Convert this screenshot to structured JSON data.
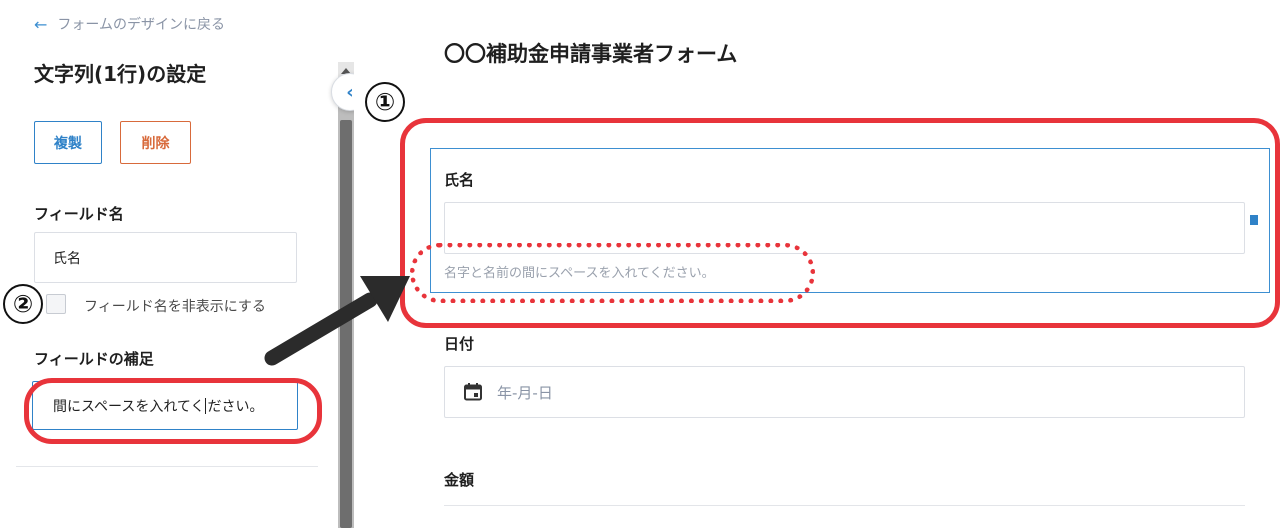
{
  "sidebar": {
    "back_label": "フォームのデザインに戻る",
    "title": "文字列(1行)の設定",
    "duplicate_label": "複製",
    "delete_label": "削除",
    "field_name_heading": "フィールド名",
    "field_name_value": "氏名",
    "hide_field_name_label": "フィールド名を非表示にする",
    "supplement_heading": "フィールドの補足",
    "supplement_value_before_caret": "間にスペースを入れてく",
    "supplement_value_after_caret": "ださい。"
  },
  "form": {
    "title": "〇〇補助金申請事業者フォーム",
    "fields": [
      {
        "label": "氏名",
        "help": "名字と名前の間にスペースを入れてください。"
      },
      {
        "label": "日付",
        "placeholder": "年-月-日"
      },
      {
        "label": "金額"
      }
    ]
  },
  "annotations": {
    "marker1": "①",
    "marker2": "②"
  },
  "icons": {
    "back": "arrow-left-icon",
    "collapse": "chevron-left-icon",
    "calendar": "calendar-icon"
  },
  "colors": {
    "accent": "#2f82c8",
    "danger": "#d86a3b",
    "annotation": "#e8343b"
  }
}
